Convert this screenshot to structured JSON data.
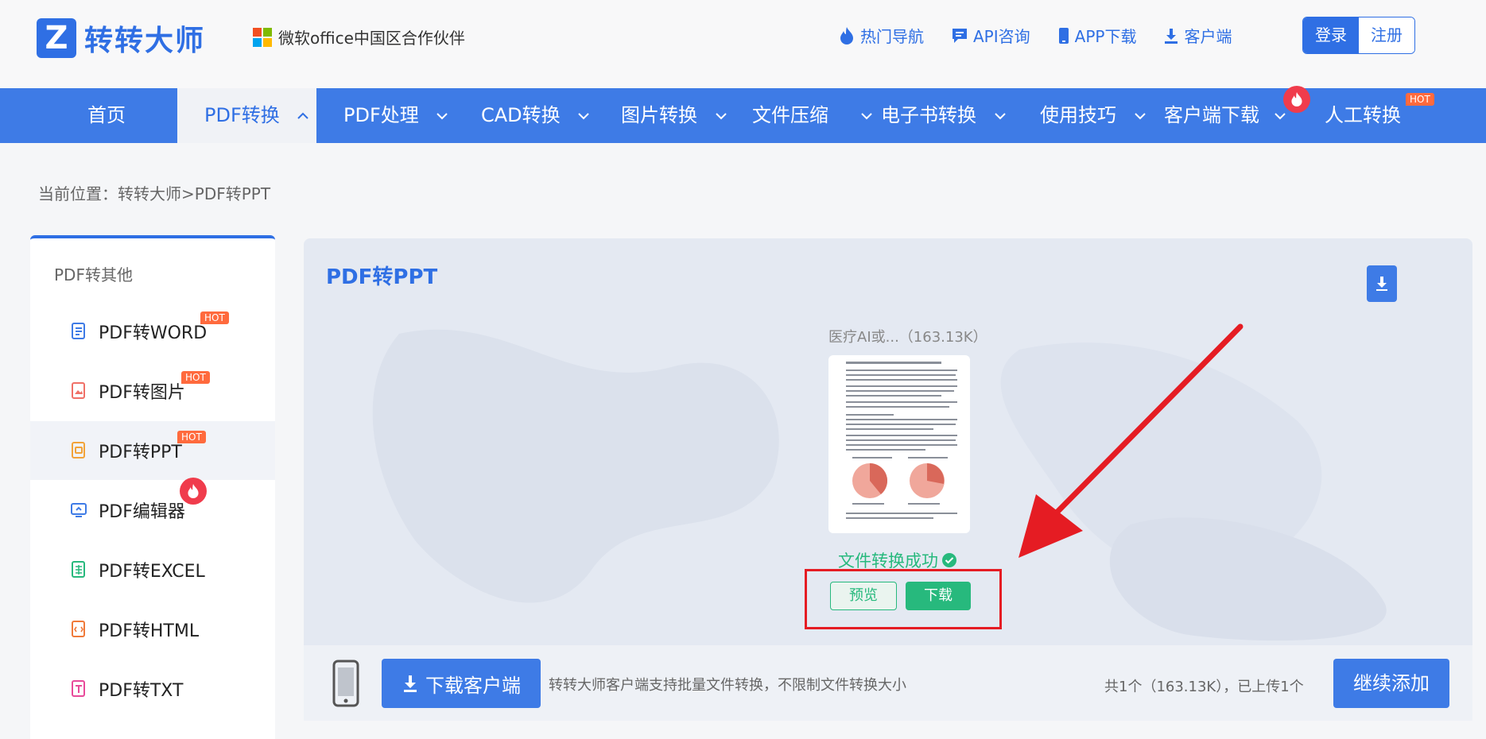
{
  "brand": {
    "logo_letter": "Z",
    "name": "转转大师",
    "partner": "微软office中国区合作伙伴"
  },
  "colors": {
    "primary": "#2f6fe4",
    "nav": "#3e7be6",
    "success": "#27b97d",
    "hot": "#ff6a3d",
    "annotation": "#e51c23"
  },
  "topnav": [
    {
      "label": "热门导航",
      "icon": "fire-icon"
    },
    {
      "label": "API咨询",
      "icon": "chat-icon"
    },
    {
      "label": "APP下载",
      "icon": "phone-icon"
    },
    {
      "label": "客户端",
      "icon": "download-icon"
    }
  ],
  "auth": {
    "login": "登录",
    "register": "注册"
  },
  "mainnav": [
    {
      "label": "首页"
    },
    {
      "label": "PDF转换",
      "active": true
    },
    {
      "label": "PDF处理"
    },
    {
      "label": "CAD转换"
    },
    {
      "label": "图片转换"
    },
    {
      "label": "文件压缩"
    },
    {
      "label": "电子书转换"
    },
    {
      "label": "使用技巧"
    },
    {
      "label": "客户端下载"
    },
    {
      "label": "人工转换",
      "badge": "HOT"
    }
  ],
  "breadcrumb": "当前位置：转转大师>PDF转PPT",
  "sidebar": {
    "title": "PDF转其他",
    "hot_label": "HOT",
    "items": [
      {
        "label": "PDF转WORD",
        "badge": "HOT"
      },
      {
        "label": "PDF转图片",
        "badge": "HOT"
      },
      {
        "label": "PDF转PPT",
        "badge": "HOT",
        "active": true
      },
      {
        "label": "PDF编辑器",
        "badge": "fire"
      },
      {
        "label": "PDF转EXCEL"
      },
      {
        "label": "PDF转HTML"
      },
      {
        "label": "PDF转TXT"
      }
    ]
  },
  "panel": {
    "title": "PDF转PPT",
    "file_name": "医疗AI或...（163.13K）",
    "status": "文件转换成功",
    "preview": "预览",
    "download": "下载"
  },
  "footer": {
    "download_client": "下载客户端",
    "note": "转转大师客户端支持批量文件转换，不限制文件转换大小",
    "count": "共1个（163.13K），已上传1个",
    "continue": "继续添加"
  }
}
